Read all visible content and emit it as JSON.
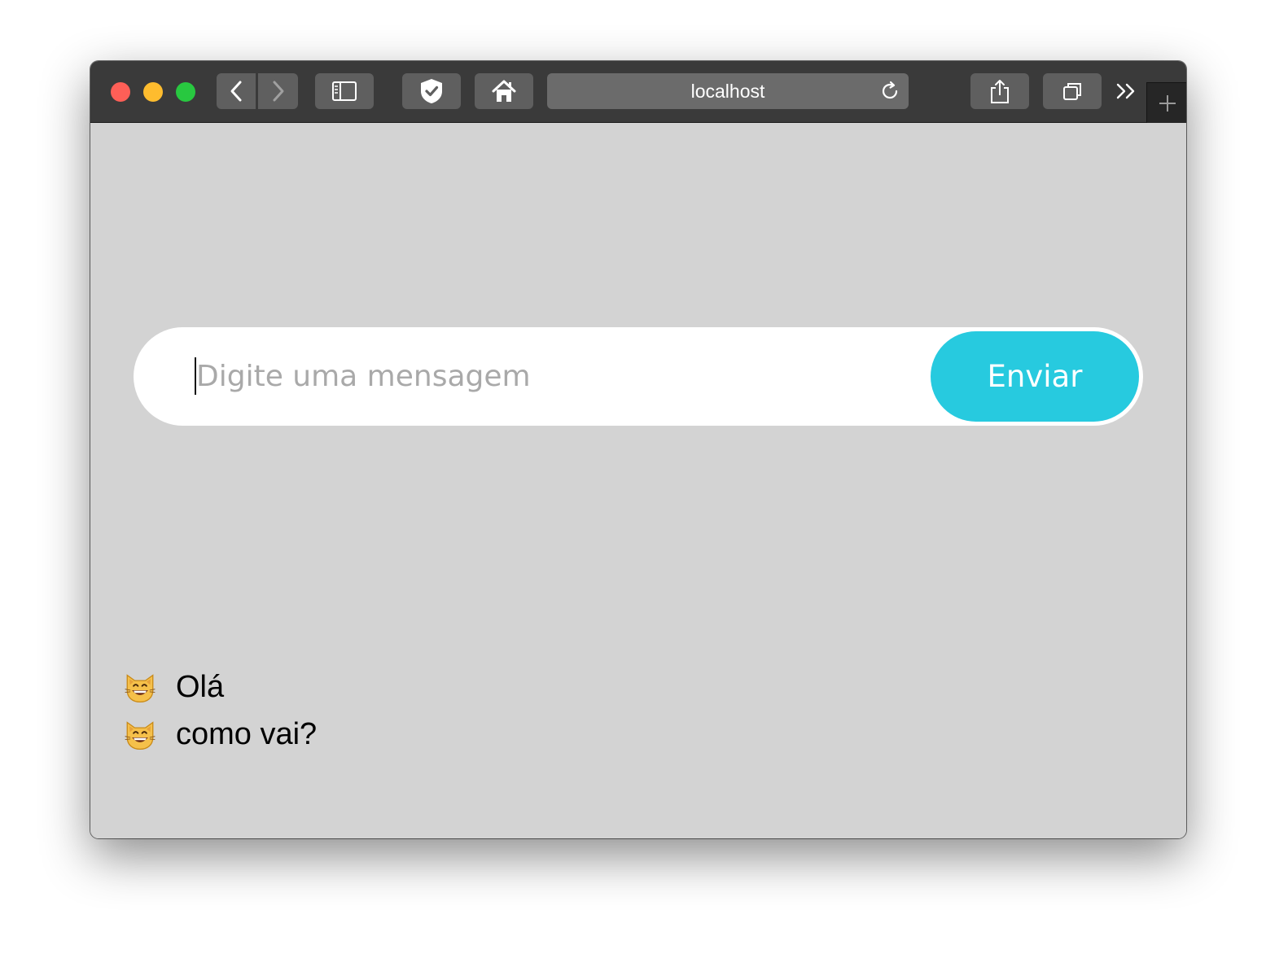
{
  "browser": {
    "address": "localhost"
  },
  "composer": {
    "placeholder": "Digite uma mensagem",
    "value": "",
    "send_label": "Enviar"
  },
  "messages": [
    {
      "icon": "grinning-cat-icon",
      "text": "Olá"
    },
    {
      "icon": "grinning-cat-icon",
      "text": "como vai?"
    }
  ],
  "colors": {
    "send_button": "#27cadf",
    "page_background": "#d3d3d3",
    "toolbar": "#3a3a3a"
  }
}
